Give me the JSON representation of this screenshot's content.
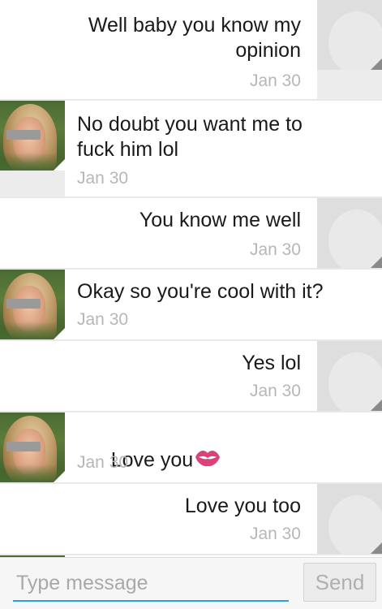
{
  "thread": {
    "messages": [
      {
        "direction": "sent",
        "text": "Well baby you know my\nopinion",
        "date": "Jan 30"
      },
      {
        "direction": "received",
        "text": "No doubt you want me to\nfuck him lol",
        "date": "Jan 30"
      },
      {
        "direction": "sent",
        "text": "You know me well",
        "date": "Jan 30"
      },
      {
        "direction": "received",
        "text": "Okay so you're cool with it?",
        "date": "Jan 30"
      },
      {
        "direction": "sent",
        "text": "Yes lol",
        "date": "Jan 30"
      },
      {
        "direction": "received",
        "text": "Love you",
        "date": "Jan 30",
        "emoji": "kiss-mark-icon"
      },
      {
        "direction": "sent",
        "text": "Love you too",
        "date": "Jan 30"
      }
    ]
  },
  "composer": {
    "placeholder": "Type message",
    "send_label": "Send"
  },
  "colors": {
    "accent": "#2aa4d6",
    "kiss": "#d9437a",
    "date_text": "#b7b7b7",
    "bubble": "#ffffff",
    "background": "#e8e8e8"
  }
}
